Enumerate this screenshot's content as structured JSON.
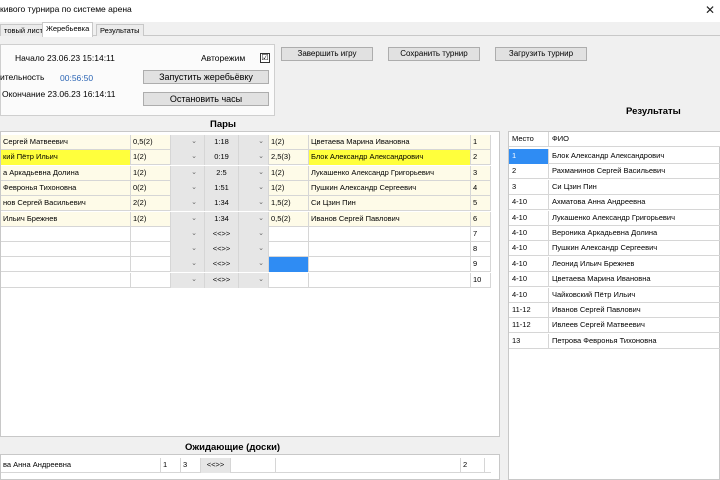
{
  "window": {
    "title": "кивого турнира по системе арена",
    "close_glyph": "✕"
  },
  "tabs": [
    {
      "label": "товый лист",
      "active": false
    },
    {
      "label": "Жеребьевка",
      "active": true
    },
    {
      "label": "Результаты",
      "active": false
    }
  ],
  "controls": {
    "start_label": "Начало 23.06.23 15:14:11",
    "duration_label": "ительность",
    "duration_value": "00:56:50",
    "end_label": "Окончание 23.06.23 16:14:11",
    "automode_label": "Авторежим",
    "automode_checked": "☑",
    "start_draw_button": "Запустить жеребьёвку",
    "stop_clock_button": "Остановить часы"
  },
  "toolbar": {
    "finish_game": "Завершить игру",
    "save_tournament": "Сохранить турнир",
    "load_tournament": "Загрузить турнир"
  },
  "pairs": {
    "title": "Пары",
    "rows": [
      {
        "left": "Сергей Матвеевич",
        "lscore": "0,5(2)",
        "time": "1:18",
        "rscore": "1(2)",
        "right": "Цветаева Марина Ивановна",
        "board": "1",
        "left_yellow": false,
        "right_yellow": false,
        "right_blue": false
      },
      {
        "left": "кий Пётр Ильич",
        "lscore": "1(2)",
        "time": "0:19",
        "rscore": "2,5(3)",
        "right": "Блок Александр Александрович",
        "board": "2",
        "left_yellow": true,
        "right_yellow": true,
        "right_blue": false
      },
      {
        "left": "а Аркадьевна Долина",
        "lscore": "1(2)",
        "time": "2:5",
        "rscore": "1(2)",
        "right": "Лукашенко Александр Григорьевич",
        "board": "3",
        "left_yellow": false,
        "right_yellow": false,
        "right_blue": false
      },
      {
        "left": "Февронья Тихоновна",
        "lscore": "0(2)",
        "time": "1:51",
        "rscore": "1(2)",
        "right": "Пушкин Александр Сергеевич",
        "board": "4",
        "left_yellow": false,
        "right_yellow": false,
        "right_blue": false
      },
      {
        "left": "нов Сергей Васильевич",
        "lscore": "2(2)",
        "time": "1:34",
        "rscore": "1,5(2)",
        "right": "Си Цзин Пин",
        "board": "5",
        "left_yellow": false,
        "right_yellow": false,
        "right_blue": false
      },
      {
        "left": "Ильич Брежнев",
        "lscore": "1(2)",
        "time": "1:34",
        "rscore": "0,5(2)",
        "right": "Иванов Сергей Павлович",
        "board": "6",
        "left_yellow": false,
        "right_yellow": false,
        "right_blue": false
      },
      {
        "left": "",
        "lscore": "",
        "time": "<<>>",
        "rscore": "",
        "right": "",
        "board": "7",
        "left_yellow": false,
        "right_yellow": false,
        "right_blue": false
      },
      {
        "left": "",
        "lscore": "",
        "time": "<<>>",
        "rscore": "",
        "right": "",
        "board": "8",
        "left_yellow": false,
        "right_yellow": false,
        "right_blue": false
      },
      {
        "left": "",
        "lscore": "",
        "time": "<<>>",
        "rscore": "",
        "right": "",
        "board": "9",
        "left_yellow": false,
        "right_yellow": false,
        "right_blue": true
      },
      {
        "left": "",
        "lscore": "",
        "time": "<<>>",
        "rscore": "",
        "right": "",
        "board": "10",
        "left_yellow": false,
        "right_yellow": false,
        "right_blue": false
      }
    ]
  },
  "results": {
    "title": "Результаты",
    "headers": [
      "Место",
      "ФИО"
    ],
    "rows": [
      {
        "place": "1",
        "name": "Блок Александр Александрович"
      },
      {
        "place": "2",
        "name": "Рахманинов Сергей Васильевич"
      },
      {
        "place": "3",
        "name": "Си Цзин Пин"
      },
      {
        "place": "4-10",
        "name": "Ахматова Анна Андреевна"
      },
      {
        "place": "4-10",
        "name": "Лукашенко Александр Григорьевич"
      },
      {
        "place": "4-10",
        "name": "Вероника Аркадьевна Долина"
      },
      {
        "place": "4-10",
        "name": "Пушкин Александр Сергеевич"
      },
      {
        "place": "4-10",
        "name": "Леонид Ильич Брежнев"
      },
      {
        "place": "4-10",
        "name": "Цветаева Марина Ивановна"
      },
      {
        "place": "4-10",
        "name": "Чайковский Пётр Ильич"
      },
      {
        "place": "11-12",
        "name": "Иванов Сергей Павлович"
      },
      {
        "place": "11-12",
        "name": "Ивлеев Сергей Матвеевич"
      },
      {
        "place": "13",
        "name": "Петрова Февронья Тихоновна"
      }
    ]
  },
  "waiting": {
    "title": "Ожидающие (доски)",
    "row": {
      "name": "ва Анна Андреевна",
      "games": "1",
      "score": "3",
      "time": "<<>>",
      "board": "2"
    }
  },
  "icons": {
    "dropdown": "chevron-down-icon",
    "checkbox": "checkbox-icon",
    "close": "close-icon"
  },
  "colors": {
    "highlight_yellow": "#ffff3c",
    "selection_blue": "#2f8cf3",
    "timer_blue": "#2a64b4"
  }
}
